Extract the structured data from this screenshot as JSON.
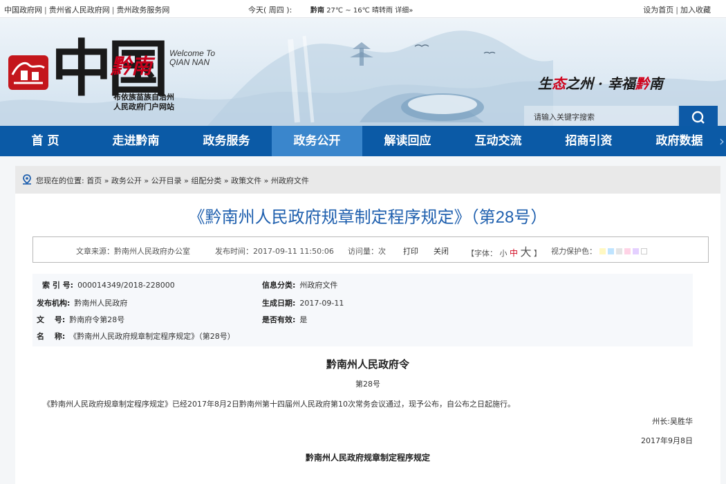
{
  "topbar": {
    "links": [
      "中国政府网",
      "贵州省人民政府网",
      "贵州政务服务网"
    ],
    "today": "今天( 周四 ):",
    "weather_city": "黔南",
    "weather_text": "27℃ ~ 16℃ 晴转雨 详细»",
    "set_home": "设为首页",
    "add_fav": "加入收藏"
  },
  "banner": {
    "logo_main": "中国",
    "logo_city": "黔南",
    "welcome_line1": "Welcome To",
    "welcome_line2": "QIAN NAN",
    "sub_line1": "布依族苗族自治州",
    "sub_line2": "人民政府门户网站",
    "slogan_a": "生",
    "slogan_b": "态",
    "slogan_c": "之州 · 幸福",
    "slogan_d": "黔",
    "slogan_e": "南",
    "search_placeholder": "请输入关键字搜索"
  },
  "nav": {
    "items": [
      {
        "label": "首 页"
      },
      {
        "label": "走进黔南"
      },
      {
        "label": "政务服务"
      },
      {
        "label": "政务公开"
      },
      {
        "label": "解读回应"
      },
      {
        "label": "互动交流"
      },
      {
        "label": "招商引资"
      },
      {
        "label": "政府数据"
      }
    ],
    "active_index": 3
  },
  "location": {
    "text": "您现在的位置: 首页 » 政务公开 » 公开目录 » 组配分类 » 政策文件 » 州政府文件"
  },
  "article": {
    "title": "《黔南州人民政府规章制定程序规定》（第28号）",
    "meta": {
      "source": "文章来源：黔南州人民政府办公室",
      "publish": "发布时间：2017-09-11 11:50:06",
      "views": "访问量：次",
      "print": "打印",
      "close": "关闭",
      "font_label": "【字体：",
      "font_small": "小",
      "font_medium": "中",
      "font_large": "大",
      "font_end": "】",
      "eye_label": "视力保护色：",
      "swatches": [
        "#fff8c2",
        "#bfe4ff",
        "#e4e4e4",
        "#ffd3e6",
        "#e4d0ff",
        "#ffffff"
      ]
    },
    "info": {
      "index_k": "索 引 号:",
      "index_v": "000014349/2018-228000",
      "category_k": "信息分类:",
      "category_v": "州政府文件",
      "org_k": "发布机构:",
      "org_v": "黔南州人民政府",
      "date_k": "生成日期:",
      "date_v": "2017-09-11",
      "docno_k": "文　 号:",
      "docno_v": "黔南府令第28号",
      "valid_k": "是否有效:",
      "valid_v": "是",
      "name_k": "名　 称:",
      "name_v": "《黔南州人民政府规章制定程序规定》（第28号）"
    },
    "doc": {
      "heading": "黔南州人民政府令",
      "number": "第28号",
      "paragraph": "《黔南州人民政府规章制定程序规定》已经2017年8月2日黔南州第十四届州人民政府第10次常务会议通过，现予公布，自公布之日起施行。",
      "signature": "州长:吴胜华",
      "sign_date": "2017年9月8日",
      "subheading": "黔南州人民政府规章制定程序规定"
    }
  }
}
